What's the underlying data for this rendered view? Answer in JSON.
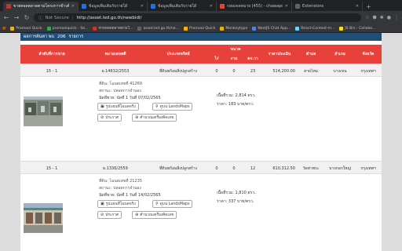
{
  "browser": {
    "tabs": [
      {
        "title": "ขายทอดตลาดตามโครงการข้างต้น",
        "active": true,
        "color": "#c0392b"
      },
      {
        "title": "ข้อมูลเพิ่มเติมรับรายได้",
        "active": false,
        "color": "#1a73e8"
      },
      {
        "title": "ข้อมูลเพิ่มเติมรับรายได้",
        "active": false,
        "color": "#1a73e8"
      },
      {
        "title": "กล่องจดหมาย (455) - chawapolk",
        "active": false,
        "color": "#ea4335"
      },
      {
        "title": "Extensions",
        "active": false,
        "color": "#5f6368"
      }
    ],
    "url": "http://asset.led.go.th/newbidl/",
    "security_label": "Not Secure",
    "bookmarks": [
      {
        "label": "Pramool Quick",
        "color": "#f4b400"
      },
      {
        "label": "promoolquick - Se...",
        "color": "#34a853"
      },
      {
        "label": "ขายทอดตลาดตามโ...",
        "color": "#c0392b"
      },
      {
        "label": "asset.led.go.th/ne...",
        "color": "#5f6368"
      },
      {
        "label": "Pramool Quick",
        "color": "#f4b400"
      },
      {
        "label": "Monkeytype",
        "color": "#e2b714"
      },
      {
        "label": "NextJS Chat App...",
        "color": "#4285f4"
      },
      {
        "label": "React-Context-m...",
        "color": "#61dafb"
      },
      {
        "label": "JS Bin - Collabo...",
        "color": "#f7df1e"
      }
    ],
    "other_bookmarks": "Other Bookmarks"
  },
  "result": {
    "label": "ผลการค้นหา พบ",
    "count": "206",
    "unit": "รายการ"
  },
  "table": {
    "headers": {
      "sale_order": "ลำดับที่การขาย",
      "case_no": "หมายเลขคดี",
      "type": "ประเภททรัพย์",
      "size": "ขนาด",
      "rai": "ไร่",
      "ngan": "งาน",
      "wa": "ตร.วา",
      "price": "ราคาประเมิน",
      "tambon": "ตำบล",
      "amphoe": "อำเภอ",
      "province": "จังหวัด"
    },
    "rows": [
      {
        "sale_order": "15 - 1",
        "case_no": "ผ.14632/2553",
        "type": "ที่ดินพร้อมสิ่งปลูกสร้าง",
        "rai": "0",
        "ngan": "0",
        "wa": "23",
        "price": "514,200.00",
        "tambon": "สายไหม",
        "amphoe": "บางเขน",
        "province": "กรุงเทพฯ",
        "deed": "ที่ดิน: โฉนดเลขที่ 41269",
        "status": "สถานะ: ปลอดการจำนอง",
        "auction_date": "นัดที่ขาย: นัดที่ 1 วันที่ 07/02/2565",
        "area": "เนื้อที่รวม: 2,814 ตรว.",
        "unit_price": "ราคา: 183 บาท/ตรว.",
        "btn_photo": "รูปแผนที่โฉนดจริง",
        "btn_map": "ดูบน LandsMaps",
        "btn_announce": "ประกาศ",
        "btn_calc": "คำนวณเครื่องคิดเลข"
      },
      {
        "sale_order": "15 - 1",
        "case_no": "ผ.1336/2559",
        "type": "ที่ดินพร้อมสิ่งปลูกสร้าง",
        "rai": "0",
        "ngan": "0",
        "wa": "12",
        "price": "610,312.50",
        "tambon": "วัดท่าพระ",
        "amphoe": "บางกอกใหญ่",
        "province": "กรุงเทพฯ",
        "deed": "ที่ดิน: โฉนดเลขที่ 21235",
        "status": "สถานะ: ปลอดการจำนอง",
        "auction_date": "นัดที่ขาย: นัดที่ 1 วันที่ 14/02/2565",
        "area": "เนื้อที่รวม: 1,810 ตรว.",
        "unit_price": "ราคา: 337 บาท/ตรว.",
        "btn_photo": "รูปแผนที่โฉนดจริง",
        "btn_map": "ดูบน LandsMaps",
        "btn_announce": "ประกาศ",
        "btn_calc": "คำนวณเครื่องคิดเลข"
      }
    ]
  }
}
